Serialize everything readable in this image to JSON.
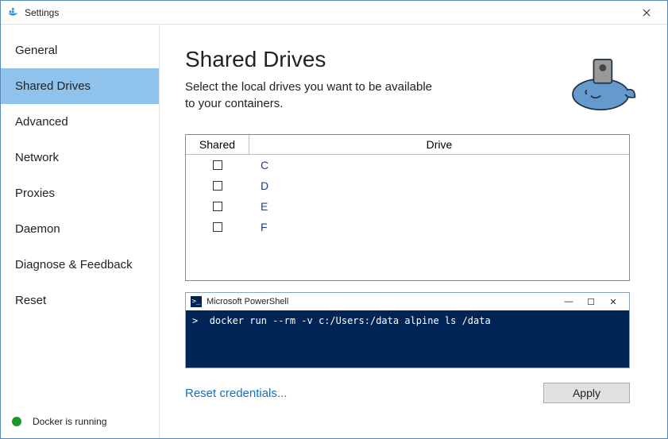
{
  "window": {
    "title": "Settings"
  },
  "sidebar": {
    "items": [
      {
        "label": "General",
        "active": false
      },
      {
        "label": "Shared Drives",
        "active": true
      },
      {
        "label": "Advanced",
        "active": false
      },
      {
        "label": "Network",
        "active": false
      },
      {
        "label": "Proxies",
        "active": false
      },
      {
        "label": "Daemon",
        "active": false
      },
      {
        "label": "Diagnose & Feedback",
        "active": false
      },
      {
        "label": "Reset",
        "active": false
      }
    ]
  },
  "status": {
    "text": "Docker is running",
    "color": "#1a962b"
  },
  "main": {
    "heading": "Shared Drives",
    "subtitle": "Select the local drives you want to be available to your containers.",
    "table": {
      "columns": {
        "shared": "Shared",
        "drive": "Drive"
      },
      "rows": [
        {
          "shared": false,
          "drive": "C"
        },
        {
          "shared": false,
          "drive": "D"
        },
        {
          "shared": false,
          "drive": "E"
        },
        {
          "shared": false,
          "drive": "F"
        }
      ]
    },
    "powershell": {
      "title": "Microsoft PowerShell",
      "prompt": ">",
      "command": "docker run --rm -v c:/Users:/data alpine ls /data"
    },
    "reset_link": "Reset credentials...",
    "apply_label": "Apply"
  }
}
